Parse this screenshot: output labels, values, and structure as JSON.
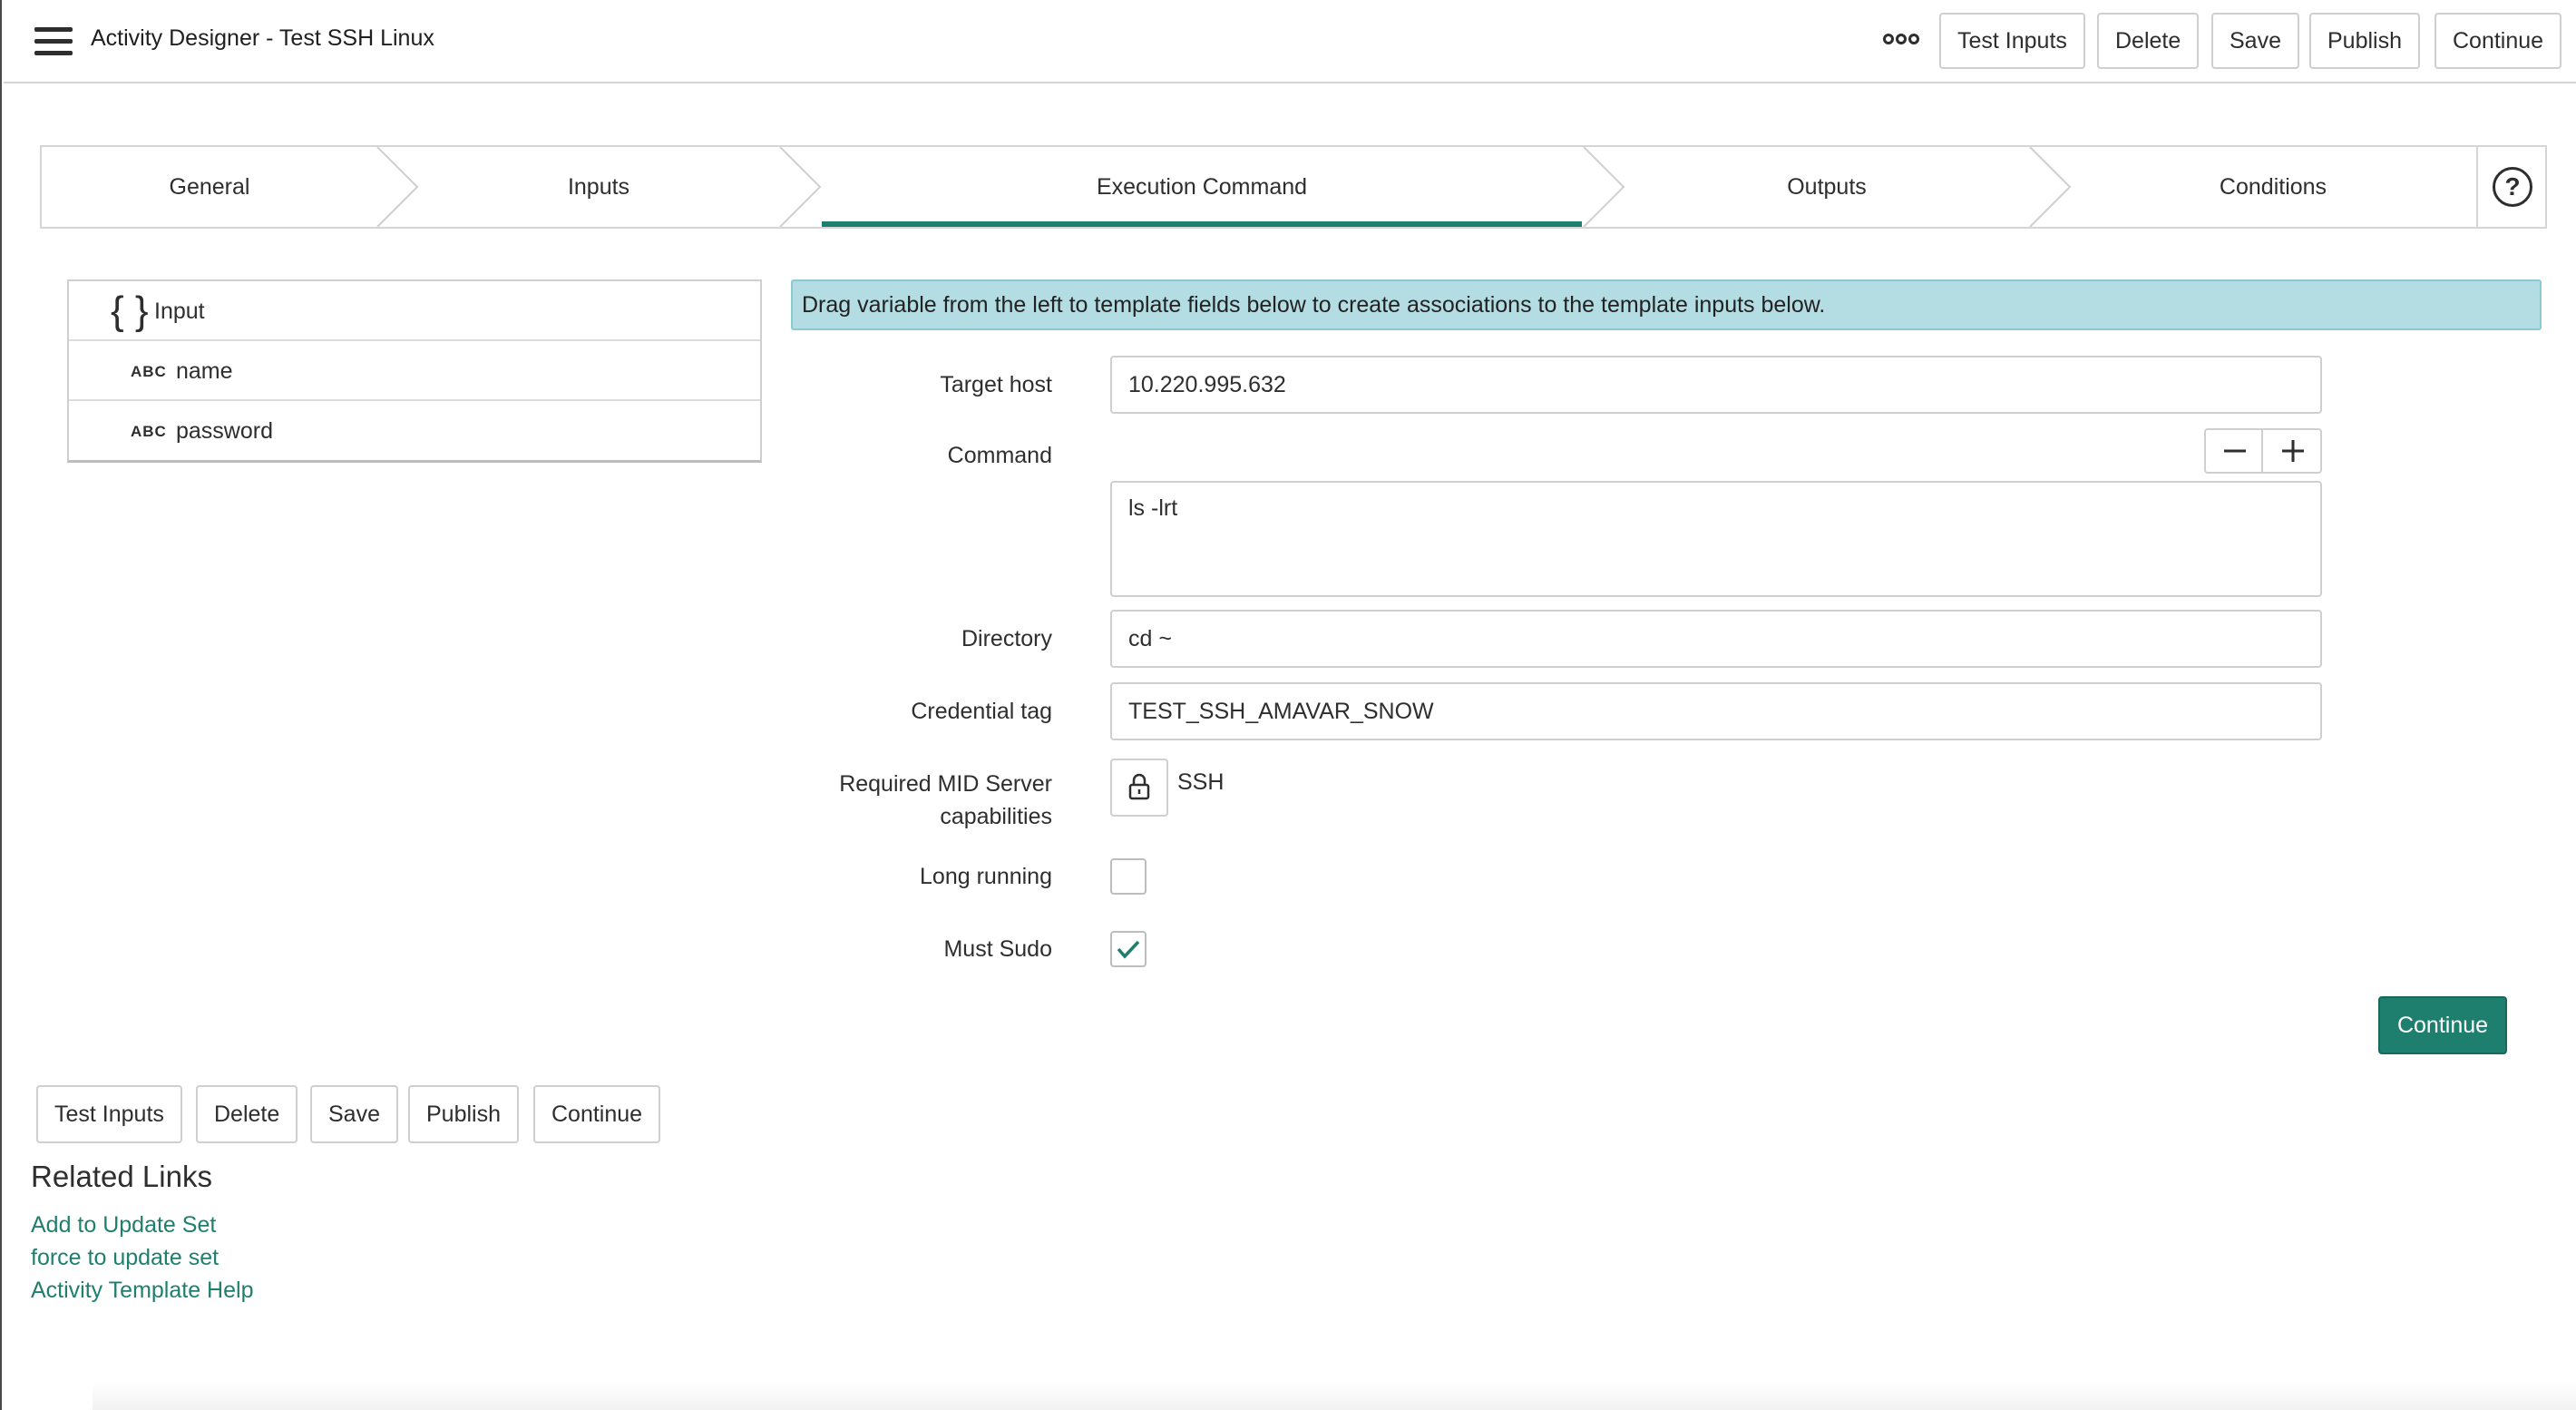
{
  "header": {
    "title": "Activity Designer - Test SSH Linux",
    "buttons": {
      "test_inputs": "Test Inputs",
      "delete": "Delete",
      "save": "Save",
      "publish": "Publish",
      "continue": "Continue"
    }
  },
  "tabs": [
    {
      "label": "General"
    },
    {
      "label": "Inputs"
    },
    {
      "label": "Execution Command",
      "active": true
    },
    {
      "label": "Outputs"
    },
    {
      "label": "Conditions"
    }
  ],
  "variables": {
    "group": "Input",
    "type_badge": "ABC",
    "items": [
      "name",
      "password"
    ]
  },
  "banner": "Drag variable from the left to template fields below to create associations to the template inputs below.",
  "form": {
    "target_host": {
      "label": "Target host",
      "value": "10.220.995.632"
    },
    "command": {
      "label": "Command",
      "value": "ls -lrt"
    },
    "directory": {
      "label": "Directory",
      "value": "cd ~"
    },
    "credential_tag": {
      "label": "Credential tag",
      "value": "TEST_SSH_AMAVAR_SNOW"
    },
    "mid_server": {
      "label_line1": "Required MID Server",
      "label_line2": "capabilities",
      "value": "SSH"
    },
    "long_running": {
      "label": "Long running",
      "checked": false
    },
    "must_sudo": {
      "label": "Must Sudo",
      "checked": true
    }
  },
  "continue_primary": "Continue",
  "bottom_buttons": {
    "test_inputs": "Test Inputs",
    "delete": "Delete",
    "save": "Save",
    "publish": "Publish",
    "continue": "Continue"
  },
  "related_links": {
    "title": "Related Links",
    "links": [
      "Add to Update Set",
      "force to update set",
      "Activity Template Help"
    ]
  },
  "colors": {
    "accent": "#1f7f6e",
    "banner_bg": "#b3dde3"
  }
}
